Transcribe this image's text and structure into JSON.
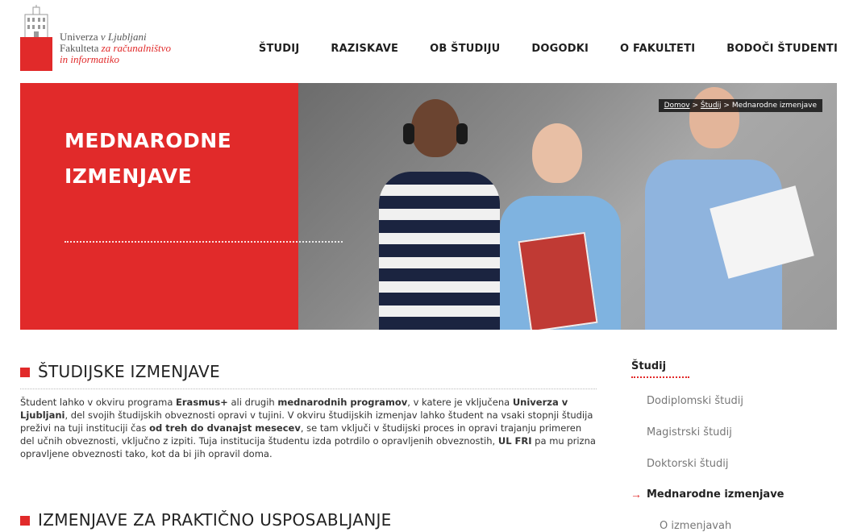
{
  "logo": {
    "line1": "Univerza ",
    "line1_italic": "v Ljubljani",
    "line2": "Fakulteta ",
    "line2_italic": "za računalništvo",
    "line3_italic": "in informatiko"
  },
  "nav": [
    "ŠTUDIJ",
    "RAZISKAVE",
    "OB ŠTUDIJU",
    "DOGODKI",
    "O FAKULTETI",
    "BODOČI ŠTUDENTI"
  ],
  "hero": {
    "title_line1": "MEDNARODNE",
    "title_line2": "IZMENJAVE",
    "breadcrumb": {
      "home": "Domov",
      "sep1": " > ",
      "study": "Študij",
      "sep2": " > ",
      "current": "Mednarodne izmenjave"
    }
  },
  "sections": {
    "s1_title": "ŠTUDIJSKE IZMENJAVE",
    "s2_title": "IZMENJAVE ZA PRAKTIČNO USPOSABLJANJE"
  },
  "body": {
    "t1": "Študent lahko v okviru programa ",
    "b1": "Erasmus+",
    "t2": " ali drugih ",
    "b2": "mednarodnih programov",
    "t3": ", v katere je vključena ",
    "b3": "Univerza v Ljubljani",
    "t4": ", del svojih študijskih obveznosti opravi v tujini. V okviru študijskih izmenjav lahko študent na vsaki stopnji študija preživi na tuji instituciji čas ",
    "b4": "od treh do dvanajst mesecev",
    "t5": ", se tam vključi v študijski proces in opravi trajanju primeren del učnih obveznosti, vključno z izpiti. Tuja institucija študentu izda potrdilo o opravljenih obveznostih, ",
    "b5": "UL FRI",
    "t6": " pa mu prizna opravljene obveznosti tako, kot da bi jih opravil doma."
  },
  "sidebar": {
    "title": "Študij",
    "items": [
      "Dodiplomski študij",
      "Magistrski študij",
      "Doktorski študij",
      "Mednarodne izmenjave"
    ],
    "arrow": "→",
    "sub": "O izmenjavah"
  },
  "colors": {
    "accent": "#e12a2a"
  }
}
